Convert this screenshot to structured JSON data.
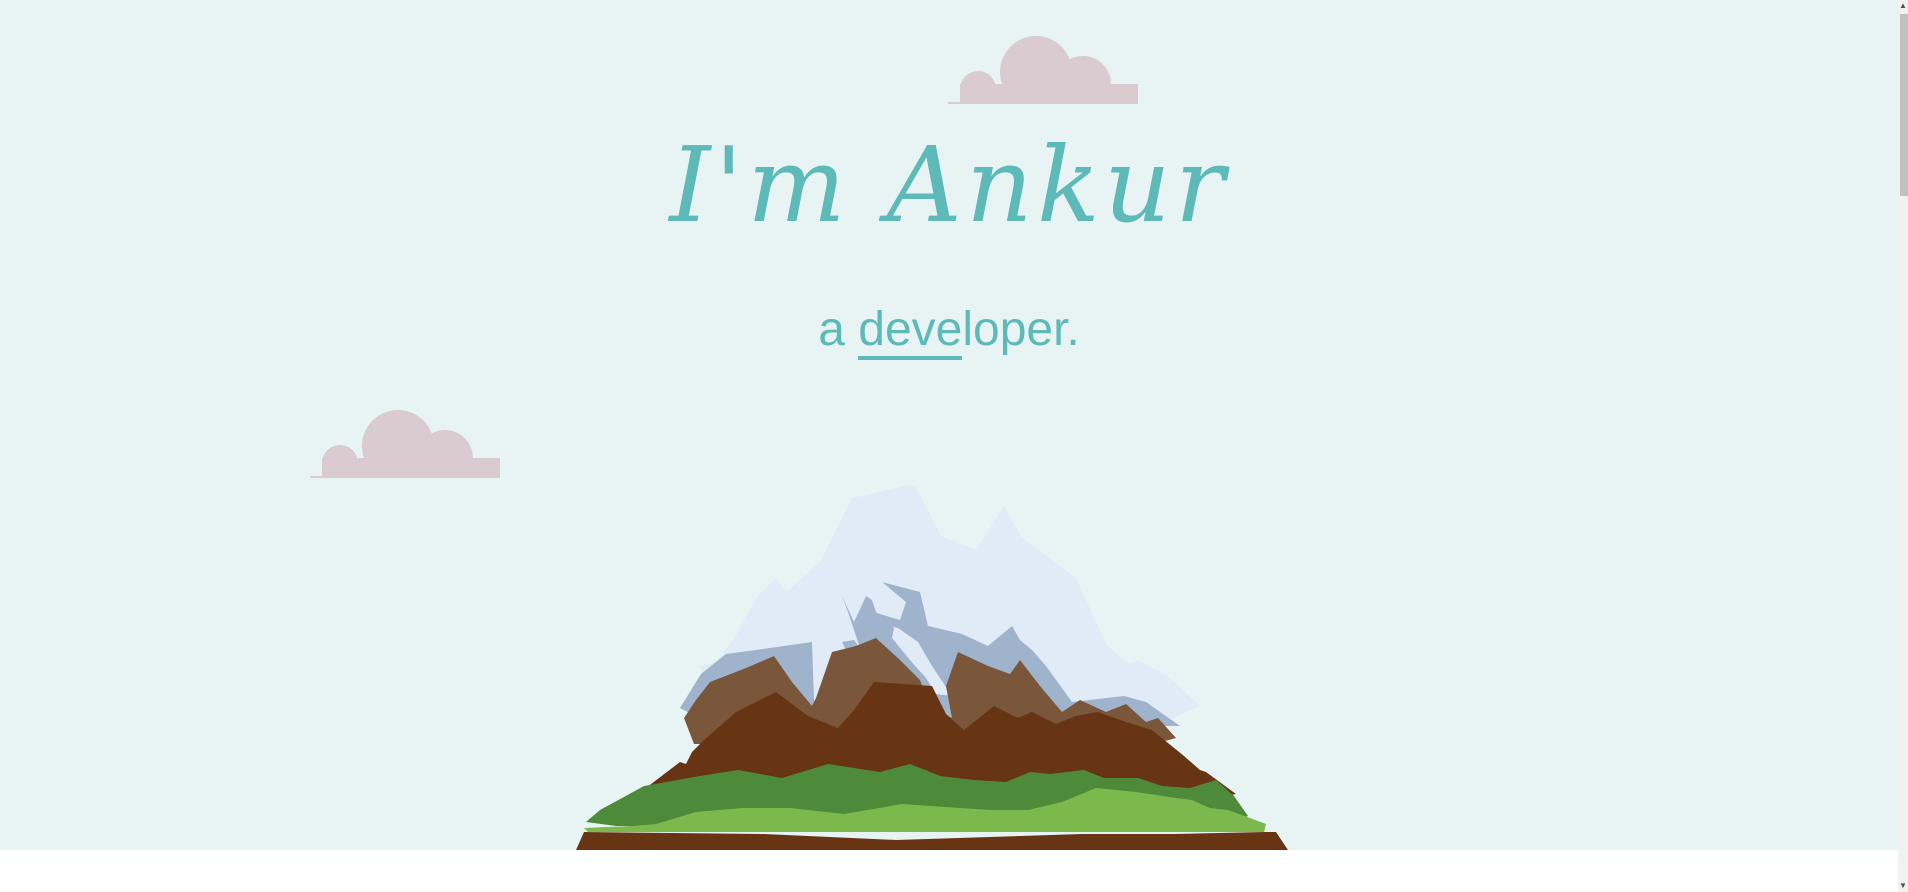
{
  "hero": {
    "heading": "I'm Ankur",
    "subtitle_prefix": "a ",
    "subtitle_typed_underlined": "deve",
    "subtitle_typed_rest": "loper."
  },
  "colors": {
    "background": "#e8f4f4",
    "accent": "#5dbab8",
    "cloud": "#d9cbd0",
    "snow": "#e0ebf7",
    "rock_shadow": "#a0b3cc",
    "rock_light": "#7a573a",
    "rock_dark": "#673514",
    "grass_dark": "#4d8a3a",
    "grass_light": "#7cb84c"
  },
  "icons": {
    "clouds": "cloud-icon",
    "mountain": "mountain-illustration",
    "scroll_up": "arrow-up-icon",
    "scroll_down": "arrow-down-icon"
  }
}
